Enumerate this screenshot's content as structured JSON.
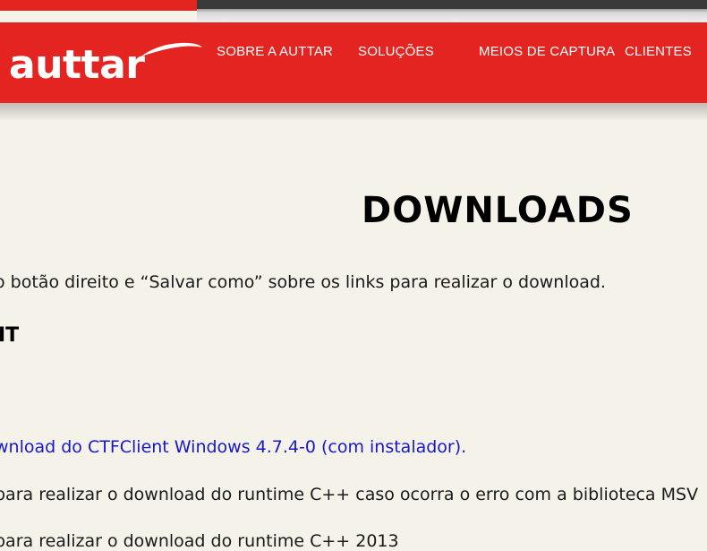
{
  "header": {
    "logo_text": "auttar",
    "nav": [
      {
        "label": "SOBRE A AUTTAR"
      },
      {
        "label": "SOLUÇÕES"
      },
      {
        "label": "MEIOS DE CAPTURA"
      },
      {
        "label": "CLIENTES"
      }
    ],
    "colors": {
      "brand": "#e42421",
      "background": "#f5f2ea",
      "link": "#1818c8"
    }
  },
  "main": {
    "title": "DOWNLOADS",
    "instruction": "o botão direito e “Salvar como” sobre os links para realizar o download.",
    "section_heading": "IT",
    "links": [
      "wnload do CTFClient Windows 4.7.4-0 (com instalador)."
    ],
    "lines": [
      "para realizar o download do runtime C++ caso ocorra o erro com a biblioteca MSV",
      "para realizar o download do runtime C++ 2013"
    ]
  }
}
